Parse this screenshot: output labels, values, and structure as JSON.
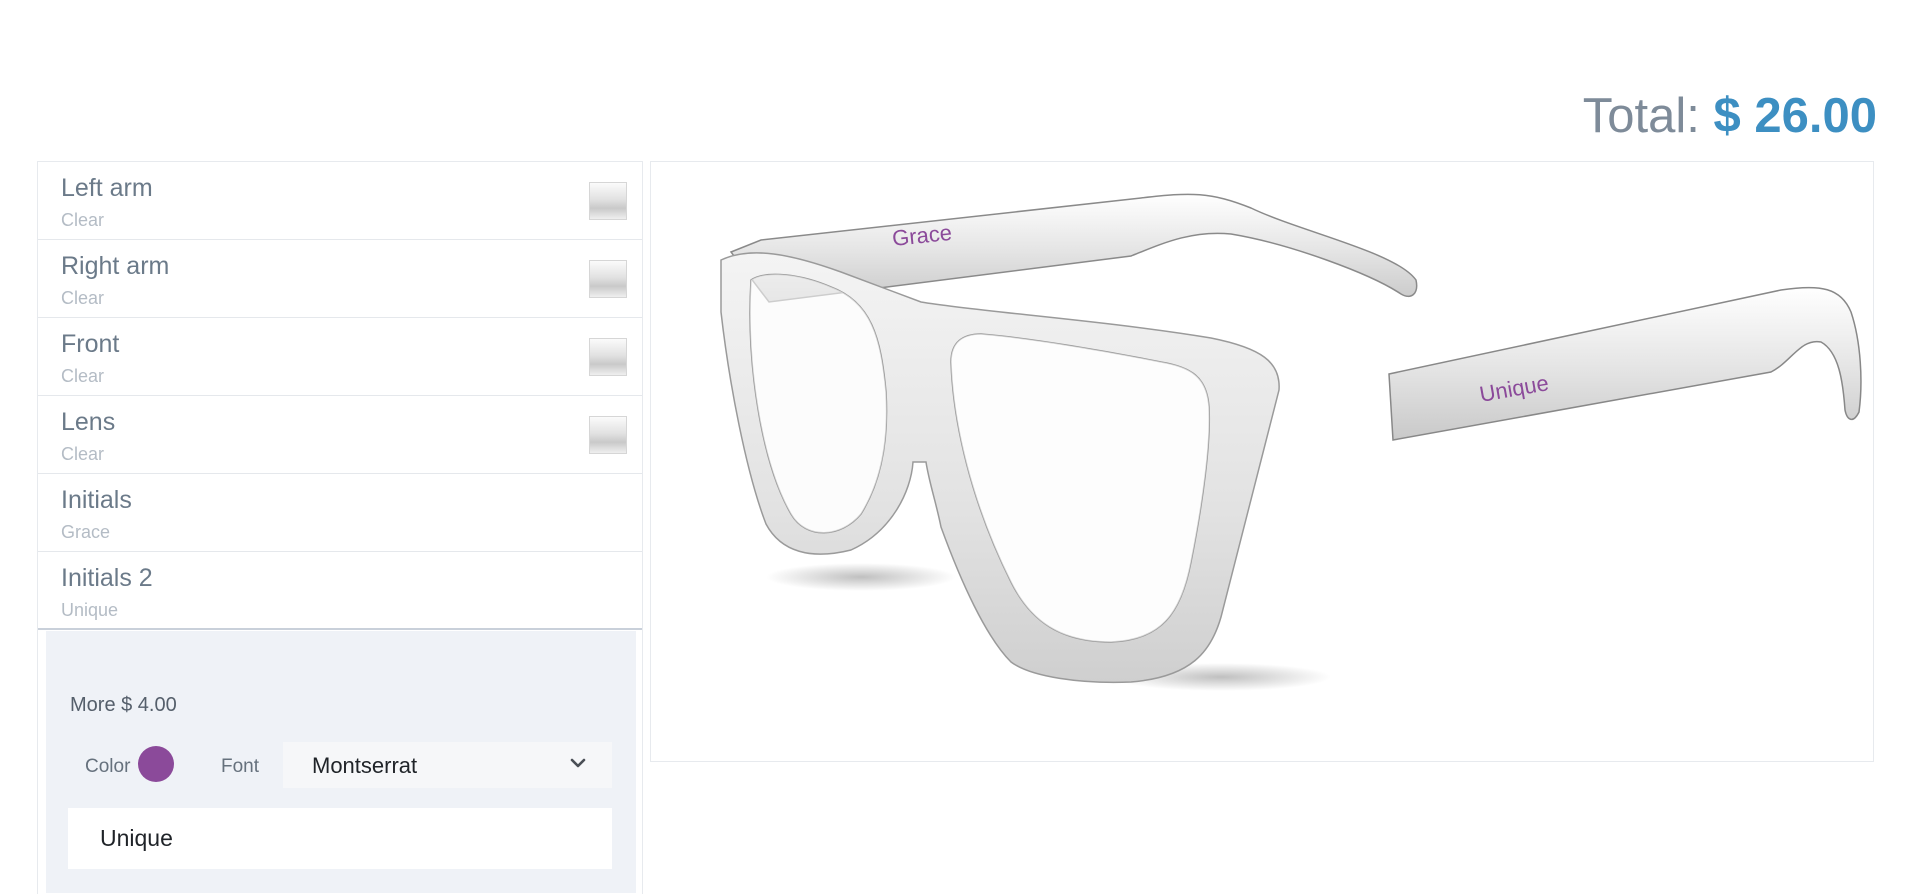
{
  "total": {
    "label": "Total:",
    "amount": "$ 26.00"
  },
  "options": [
    {
      "name": "Left arm",
      "value": "Clear",
      "has_swatch": true
    },
    {
      "name": "Right arm",
      "value": "Clear",
      "has_swatch": true
    },
    {
      "name": "Front",
      "value": "Clear",
      "has_swatch": true
    },
    {
      "name": "Lens",
      "value": "Clear",
      "has_swatch": true
    },
    {
      "name": "Initials",
      "value": "Grace",
      "has_swatch": false
    },
    {
      "name": "Initials 2",
      "value": "Unique",
      "has_swatch": false
    }
  ],
  "editor": {
    "more_label": "More $ 4.00",
    "color_label": "Color",
    "color_value": "#8b4a9a",
    "font_label": "Font",
    "font_value": "Montserrat",
    "text_value": "Unique"
  },
  "preview": {
    "left_arm_text": "Grace",
    "right_arm_text": "Unique",
    "engraving_color": "#8b4a9a"
  },
  "icons": {
    "select": "chevron-down-icon"
  }
}
